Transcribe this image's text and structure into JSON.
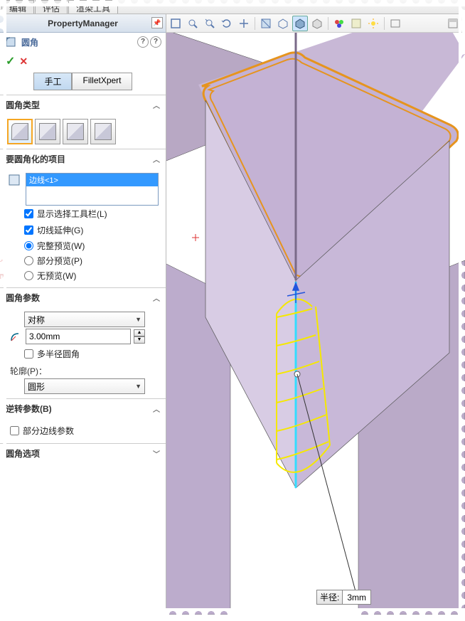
{
  "tabs": {
    "t1": "编辑",
    "t2": "评估",
    "t3": "渲染工具"
  },
  "pm": {
    "title": "PropertyManager"
  },
  "feature": {
    "name": "圆角",
    "help1": "?",
    "help2": "?"
  },
  "mode": {
    "manual": "手工",
    "xpert": "FilletXpert"
  },
  "sec_type": {
    "title": "圆角类型"
  },
  "sec_items": {
    "title": "要圆角化的项目",
    "sel": "边线<1>",
    "chk_toolbar": "显示选择工具栏(L)",
    "chk_tangent": "切线延伸(G)",
    "rad_full": "完整预览(W)",
    "rad_partial": "部分预览(P)",
    "rad_none": "无预览(W)"
  },
  "sec_params": {
    "title": "圆角参数",
    "symmetry": "对称",
    "radius": "3.00mm",
    "multi": "多半径圆角",
    "profile_lbl": "轮廓(P)：",
    "profile": "圆形"
  },
  "sec_reverse": {
    "title": "逆转参数(B)",
    "partial": "部分边线参数"
  },
  "sec_options": {
    "title": "圆角选项"
  },
  "callout": {
    "label": "半径:",
    "value": "3mm"
  }
}
